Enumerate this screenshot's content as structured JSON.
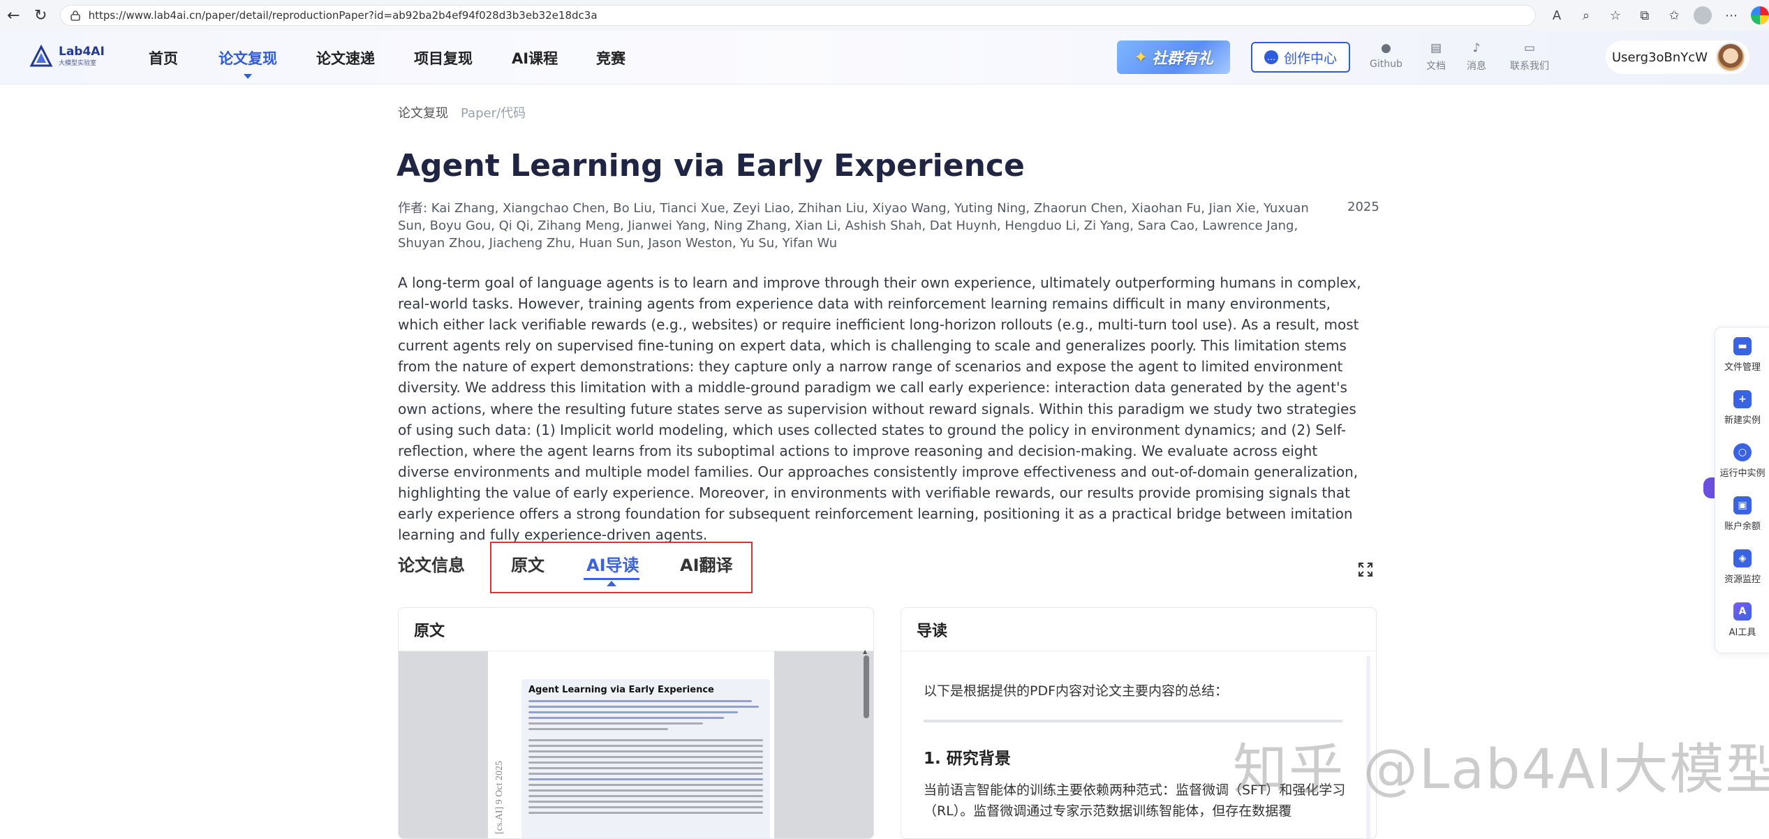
{
  "browser": {
    "url": "https://www.lab4ai.cn/paper/detail/reproductionPaper?id=ab92ba2b4ef94f028d3b3eb32e18dc3a"
  },
  "header": {
    "logo_name": "Lab4AI",
    "logo_sub": "大模型实验室",
    "nav": [
      "首页",
      "论文复现",
      "论文速递",
      "项目复现",
      "AI课程",
      "竞赛"
    ],
    "active_nav": "论文复现",
    "promo": "社群有礼",
    "create": "创作中心",
    "links": [
      "Github",
      "文档",
      "消息",
      "联系我们"
    ],
    "username": "Userg3oBnYcW"
  },
  "breadcrumb": [
    "论文复现",
    "Paper/代码"
  ],
  "paper": {
    "title": "Agent Learning via Early Experience",
    "authors": "作者: Kai Zhang, Xiangchao Chen, Bo Liu, Tianci Xue, Zeyi Liao, Zhihan Liu, Xiyao Wang, Yuting Ning, Zhaorun Chen, Xiaohan Fu, Jian Xie, Yuxuan Sun, Boyu Gou, Qi Qi, Zihang Meng, Jianwei Yang, Ning Zhang, Xian Li, Ashish Shah, Dat Huynh, Hengduo Li, Zi Yang, Sara Cao, Lawrence Jang, Shuyan Zhou, Jiacheng Zhu, Huan Sun, Jason Weston, Yu Su, Yifan Wu",
    "year": "2025",
    "abstract": "A long-term goal of language agents is to learn and improve through their own experience, ultimately outperforming humans in complex, real-world tasks. However, training agents from experience data with reinforcement learning remains difficult in many environments, which either lack verifiable rewards (e.g., websites) or require inefficient long-horizon rollouts (e.g., multi-turn tool use). As a result, most current agents rely on supervised fine-tuning on expert data, which is challenging to scale and generalizes poorly. This limitation stems from the nature of expert demonstrations: they capture only a narrow range of scenarios and expose the agent to limited environment diversity. We address this limitation with a middle-ground paradigm we call early experience: interaction data generated by the agent's own actions, where the resulting future states serve as supervision without reward signals. Within this paradigm we study two strategies of using such data: (1) Implicit world modeling, which uses collected states to ground the policy in environment dynamics; and (2) Self-reflection, where the agent learns from its suboptimal actions to improve reasoning and decision-making. We evaluate across eight diverse environments and multiple model families. Our approaches consistently improve effectiveness and out-of-domain generalization, highlighting the value of early experience. Moreover, in environments with verifiable rewards, our results provide promising signals that early experience offers a strong foundation for subsequent reinforcement learning, positioning it as a practical bridge between imitation learning and fully experience-driven agents."
  },
  "tabs": {
    "label": "论文信息",
    "items": [
      "原文",
      "AI导读",
      "AI翻译"
    ],
    "active": "AI导读"
  },
  "panels": {
    "left_title": "原文",
    "right_title": "导读",
    "pdf_title": "Agent Learning via Early Experience",
    "pdf_side": "[cs.AI]  9 Oct 2025",
    "guide_intro": "以下是根据提供的PDF内容对论文主要内容的总结：",
    "guide_h1": "1. 研究背景",
    "guide_p": "当前语言智能体的训练主要依赖两种范式：监督微调（SFT）和强化学习（RL）。监督微调通过专家示范数据训练智能体，但存在数据覆"
  },
  "float_bar": [
    "文件管理",
    "新建实例",
    "运行中实例",
    "账户余额",
    "资源监控",
    "AI工具"
  ],
  "watermark": "知乎 @Lab4AI大模型",
  "colors": {
    "accent": "#2f5bdc",
    "highlight_box": "#d9342b"
  }
}
